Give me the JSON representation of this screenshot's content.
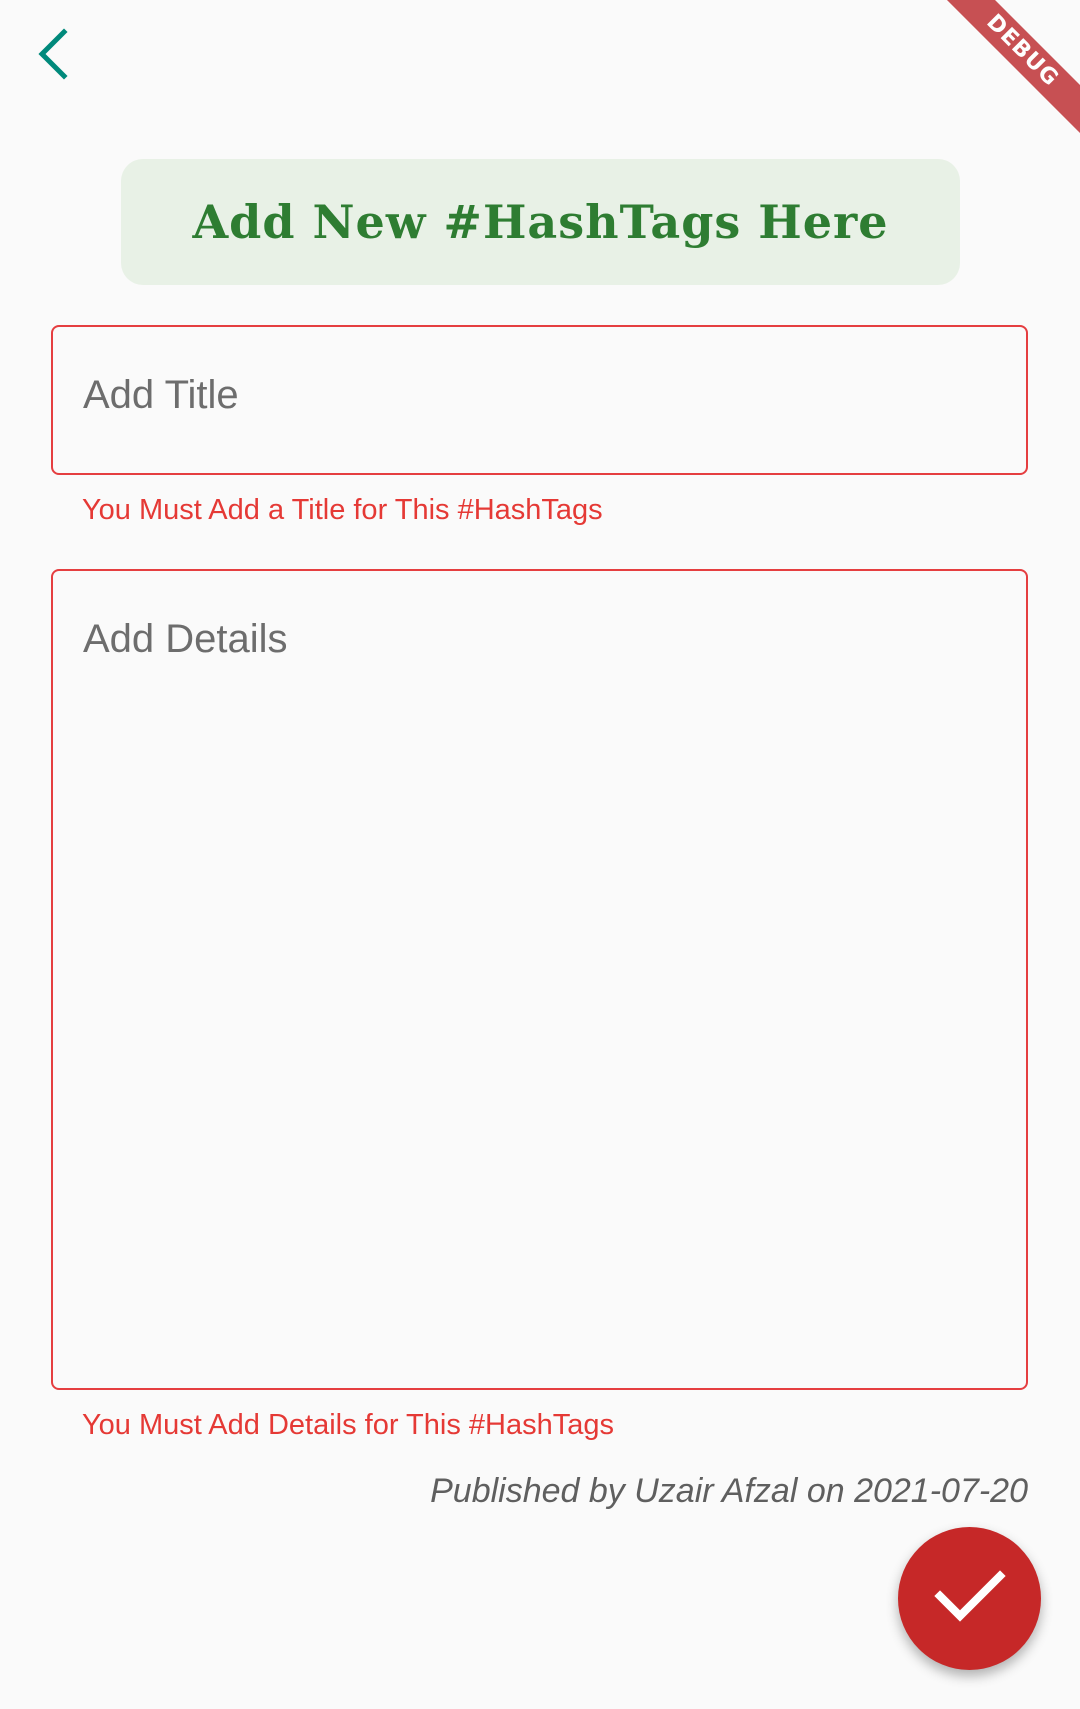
{
  "nav": {
    "back_icon": "chevron-left-icon",
    "back_color": "#00897b"
  },
  "debug_banner": {
    "label": "DEBUG"
  },
  "header": {
    "title": "Add New #HashTags Here",
    "color": "#2e7d32",
    "background": "#e8f1e6"
  },
  "form": {
    "title_field": {
      "placeholder": "Add Title",
      "value": "",
      "error": "You Must Add a Title for This #HashTags"
    },
    "details_field": {
      "placeholder": "Add Details",
      "value": "",
      "error": "You Must Add Details for This #HashTags"
    },
    "error_color": "#e53935"
  },
  "footer": {
    "published": "Published by Uzair Afzal on 2021-07-20"
  },
  "fab": {
    "icon": "check-icon",
    "color": "#c62828"
  }
}
